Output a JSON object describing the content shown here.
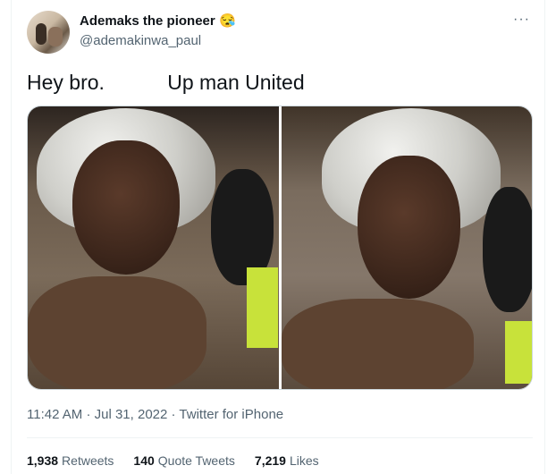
{
  "author": {
    "display_name": "Ademaks the pioneer",
    "emoji": "😪",
    "handle": "@ademakinwa_paul"
  },
  "more_icon": "more-horizontal-icon",
  "tweet": {
    "text": "Hey bro.           Up man United"
  },
  "media": {
    "count": 2
  },
  "meta": {
    "time": "11:42 AM",
    "date": "Jul 31, 2022",
    "source": "Twitter for iPhone",
    "sep": "·"
  },
  "stats": {
    "retweets_count": "1,938",
    "retweets_label": "Retweets",
    "quotes_count": "140",
    "quotes_label": "Quote Tweets",
    "likes_count": "7,219",
    "likes_label": "Likes"
  },
  "colors": {
    "text": "#0f1419",
    "secondary": "#536471",
    "border": "#eff3f4"
  }
}
